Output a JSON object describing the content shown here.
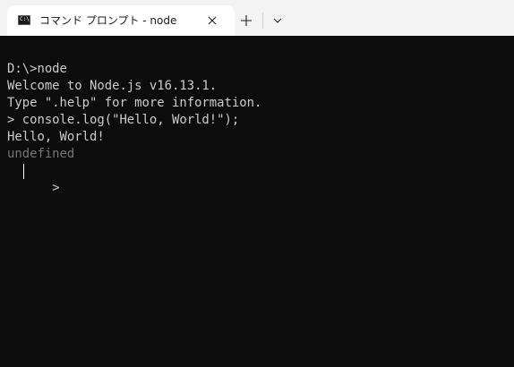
{
  "tab": {
    "icon_text": "C:\\",
    "title": "コマンド プロンプト - node"
  },
  "terminal": {
    "lines": [
      "D:\\>node",
      "Welcome to Node.js v16.13.1.",
      "Type \".help\" for more information.",
      "> console.log(\"Hello, World!\");",
      "Hello, World!",
      "undefined",
      "> "
    ]
  },
  "colors": {
    "terminal_bg": "#0c0c0c",
    "terminal_fg": "#cccccc",
    "dim_fg": "#767676",
    "titlebar_bg": "#f3f3f3",
    "active_tab_bg": "#ffffff"
  },
  "icons": {
    "tab_icon": "command-prompt-icon",
    "close": "close-icon",
    "new_tab": "plus-icon",
    "dropdown": "chevron-down-icon"
  }
}
